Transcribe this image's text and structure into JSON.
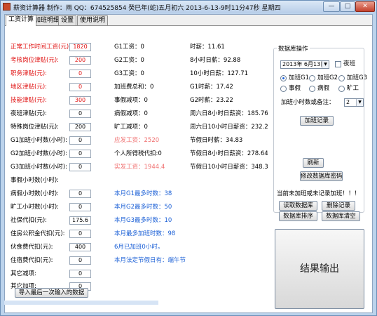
{
  "window": {
    "title": "薪资计算器   制作：雨 QQ：674525854     癸巳年(蛇)五月初六 2013-6-13-9时11分47秒   星期四",
    "min": "—",
    "max": "□",
    "close": "✕"
  },
  "tabs": [
    "工资计算",
    "加班明细",
    "设置",
    "使用说明"
  ],
  "left_fields": [
    {
      "label": "正常工作时间工资(元):",
      "value": "1820",
      "style": "red"
    },
    {
      "label": "考核岗位津贴(元):",
      "value": "200",
      "style": "red"
    },
    {
      "label": "职务津贴(元):",
      "value": "0",
      "style": "red"
    },
    {
      "label": "地区津贴(元):",
      "value": "0",
      "style": "red"
    },
    {
      "label": "技能津贴(元):",
      "value": "300",
      "style": "red"
    },
    {
      "label": "夜班津贴(元):",
      "value": "0",
      "style": ""
    },
    {
      "label": "特殊岗位津贴(元):",
      "value": "200",
      "style": ""
    },
    {
      "label": "G1加班小时数(小时):",
      "value": "0",
      "style": ""
    },
    {
      "label": "G2加班小时数(小时):",
      "value": "0",
      "style": ""
    },
    {
      "label": "G3加班小时数(小时):",
      "value": "0",
      "style": ""
    },
    {
      "label": "事假小时数(小时):",
      "value": "",
      "style": ""
    },
    {
      "label": "病假小时数(小时):",
      "value": "0",
      "style": ""
    },
    {
      "label": "旷工小时数(小时):",
      "value": "0",
      "style": ""
    },
    {
      "label": "社保代扣(元):",
      "value": "175.6",
      "style": ""
    },
    {
      "label": "住房公积金代扣(元):",
      "value": "0",
      "style": ""
    },
    {
      "label": "伙食费代扣(元):",
      "value": "400",
      "style": ""
    },
    {
      "label": "住宿费代扣(元):",
      "value": "0",
      "style": ""
    },
    {
      "label": "其它减项:",
      "value": "0",
      "style": ""
    },
    {
      "label": "其它加项:",
      "value": "0",
      "style": ""
    }
  ],
  "import_button": "导入最后一次输入的数据",
  "middle_col": [
    {
      "text": "G1工资：0",
      "style": ""
    },
    {
      "text": "G2工资：0",
      "style": ""
    },
    {
      "text": "G3工资：0",
      "style": ""
    },
    {
      "text": "加班费总和：0",
      "style": ""
    },
    {
      "text": "事假减项：0",
      "style": ""
    },
    {
      "text": "病假减项：0",
      "style": ""
    },
    {
      "text": "旷工减项：0",
      "style": ""
    },
    {
      "text": "应发工资：2520",
      "style": "pink"
    },
    {
      "text": "个人所得税代扣:0",
      "style": ""
    },
    {
      "text": "实发工资：1944.4",
      "style": "pink"
    }
  ],
  "right_col": [
    {
      "text": "时薪：11.61"
    },
    {
      "text": "8小时日薪：92.88"
    },
    {
      "text": "10小时日薪：127.71"
    },
    {
      "text": "G1时薪：17.42"
    },
    {
      "text": "G2时薪：23.22"
    },
    {
      "text": "周六日8小时日薪资：185.76"
    },
    {
      "text": "周六日10小时日薪资：232.2"
    },
    {
      "text": "节假日时薪：34.83"
    },
    {
      "text": "节假日8小时日薪资：278.64"
    },
    {
      "text": "节假日10小时日薪资：348.3"
    }
  ],
  "monthly_stats": [
    "本月G1最多时数：38",
    "本月G2最多时数：50",
    "本月G3最多时数：10",
    "本月最多加班时数：98",
    "6月已加班0小时。",
    "本月法定节假日有：端午节"
  ],
  "db_panel": {
    "title": "数据库操作",
    "date": "2013年 6月13日",
    "night_shift_label": "夜班",
    "radios": [
      {
        "label": "加班G1",
        "checked": true
      },
      {
        "label": "加班G2",
        "checked": false
      },
      {
        "label": "加班G3",
        "checked": false
      },
      {
        "label": "事假",
        "checked": false
      },
      {
        "label": "病假",
        "checked": false
      },
      {
        "label": "旷工",
        "checked": false
      }
    ],
    "hours_label": "加班小时数或备注：",
    "hours_value": "2",
    "add_button": "加班记录",
    "refresh_button": "刷新",
    "change_pw_button": "修改数据库密码"
  },
  "notice": "当前未加班或未记录加班！！！",
  "actions": {
    "read_db": "读取数据库",
    "delete_record": "删除记录",
    "sort_db": "数据库排序",
    "clear_db": "数据库清空"
  },
  "output_button": "结果输出"
}
